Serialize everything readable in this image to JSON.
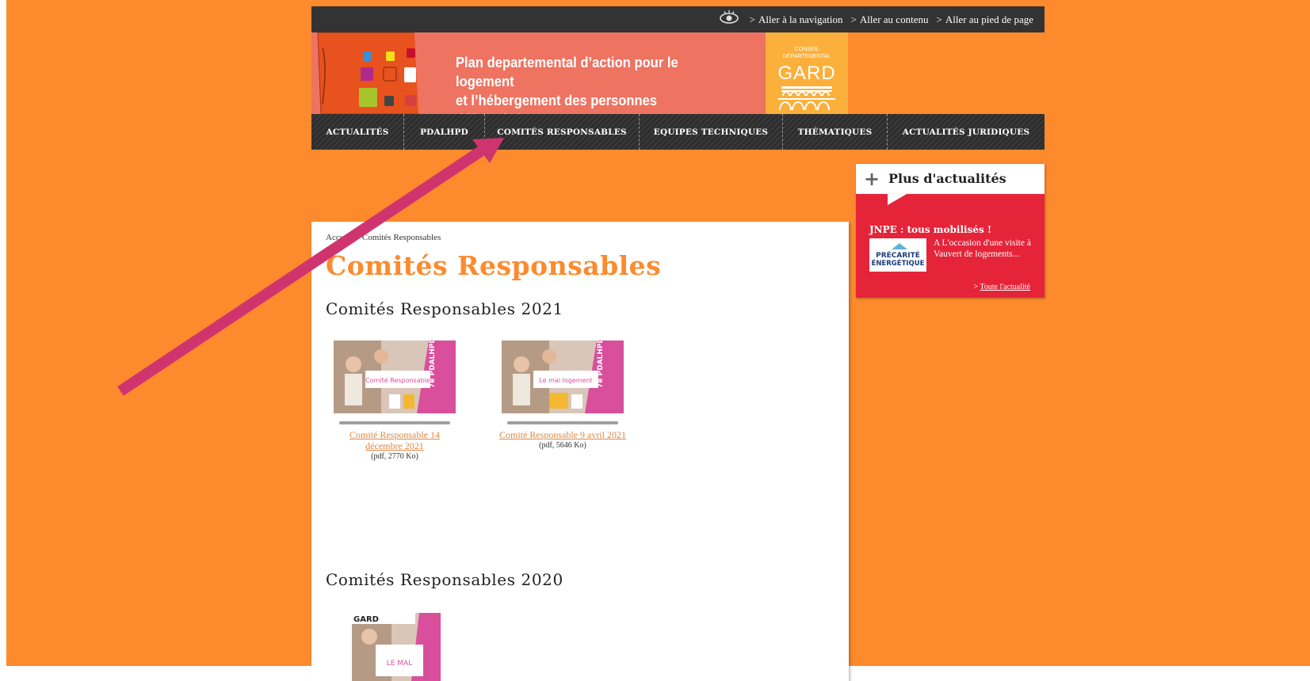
{
  "topbar": {
    "skip_links": [
      {
        "label": "Aller à la navigation"
      },
      {
        "label": "Aller au contenu"
      },
      {
        "label": "Aller au pied de page"
      }
    ],
    "gt": ">"
  },
  "header": {
    "title_line1": "Plan departemental d’action pour le logement",
    "title_line2": "et l’hébergement des personnes défavorisées",
    "gard_small_1": "CONSEIL",
    "gard_small_2": "DÉPARTEMENTAL",
    "gard_big": "GARD"
  },
  "nav": {
    "items": [
      {
        "label": "ACTUALITÉS"
      },
      {
        "label": "PDALHPD"
      },
      {
        "label": "COMITÉS RESPONSABLES"
      },
      {
        "label": "EQUIPES TECHNIQUES"
      },
      {
        "label": "THÉMATIQUES"
      },
      {
        "label": "ACTUALITÉS JURIDIQUES"
      }
    ]
  },
  "breadcrumb": {
    "home": "Accueil",
    "sep": ">",
    "current": "Comités Responsables"
  },
  "main": {
    "title": "Comités Responsables",
    "sections": [
      {
        "title": "Comités Responsables 2021",
        "docs": [
          {
            "thumb_label": "Comité Responsable",
            "link": "Comité Responsable 14 décembre 2021",
            "meta": "(pdf, 2770 Ko)"
          },
          {
            "thumb_label": "Le mal logement",
            "link": "Comité Responsable 9 avril 2021",
            "meta": "(pdf, 5646 Ko)"
          }
        ]
      },
      {
        "title": "Comités Responsables 2020",
        "docs": [
          {
            "thumb_label": "LE MAL",
            "thumb_top": "GARD"
          }
        ]
      }
    ],
    "thumb_side_text": "7e PDALHPD"
  },
  "sidebar": {
    "plus": "+",
    "title": "Plus d'actualités",
    "news": {
      "title": "JNPE : tous mobilisés !",
      "text": "A L'occasion d'une visite à Vauvert de logements...",
      "img_text_1": "PRÉCARITÉ",
      "img_text_2": "ÉNERGÉTIQUE",
      "more_prefix": ">",
      "more": "Toute l'actualité"
    }
  },
  "colors": {
    "page_bg": "#fd8a2c",
    "banner": "#ee7361",
    "gard": "#fbb03b",
    "sidebar_red": "#e5243a",
    "arrow": "#d0346f"
  }
}
